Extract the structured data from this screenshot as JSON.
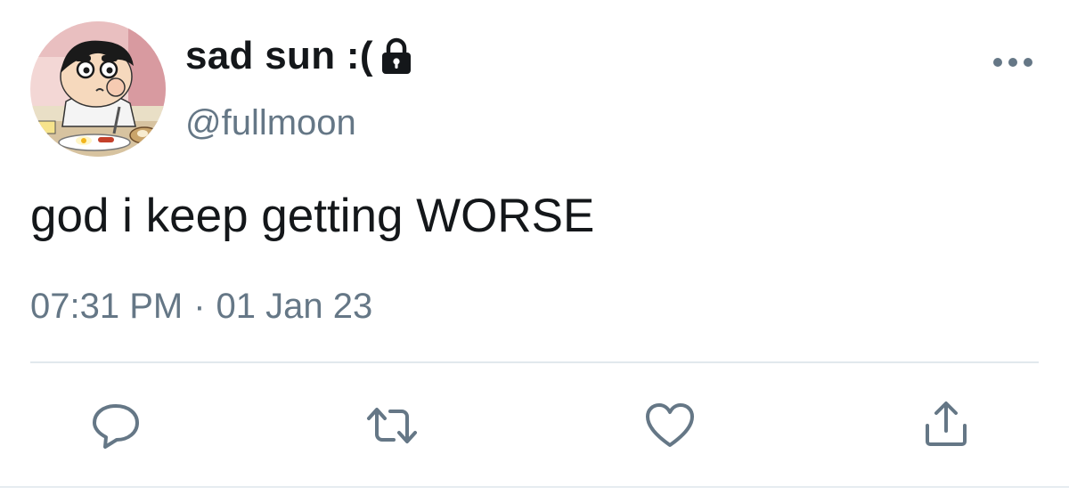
{
  "user": {
    "display_name": "sad sun :(",
    "handle": "@fullmoon",
    "protected": true,
    "avatar_icon": "cartoon-boy-eating-avatar"
  },
  "tweet": {
    "text": "god i keep getting WORSE",
    "time": "07:31 PM",
    "separator": "·",
    "date": "01 Jan 23"
  },
  "actions": [
    {
      "name": "reply",
      "icon": "speech-bubble-icon"
    },
    {
      "name": "retweet",
      "icon": "retweet-arrows-icon"
    },
    {
      "name": "like",
      "icon": "heart-icon"
    },
    {
      "name": "share",
      "icon": "share-upload-icon"
    }
  ],
  "colors": {
    "text_primary": "#14171a",
    "text_secondary": "#657786",
    "icon": "#657786",
    "divider": "#e1e8ed"
  }
}
